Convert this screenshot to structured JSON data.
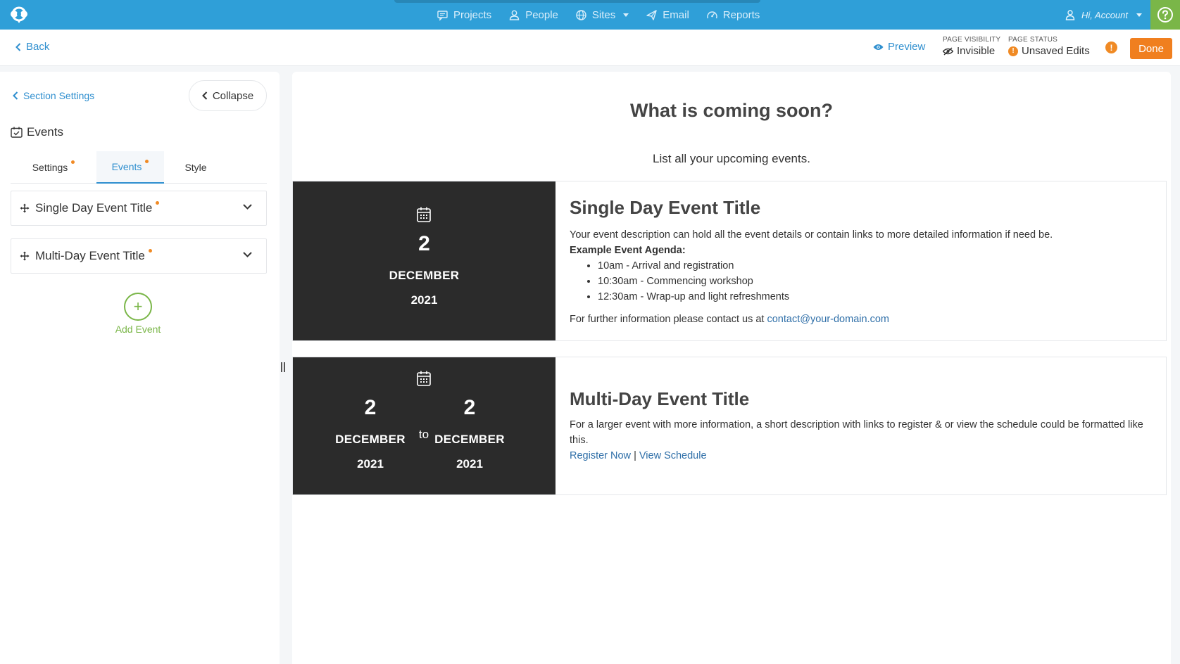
{
  "nav": {
    "items": [
      {
        "label": "Projects",
        "icon": "chat-icon"
      },
      {
        "label": "People",
        "icon": "person-icon"
      },
      {
        "label": "Sites",
        "icon": "globe-icon"
      },
      {
        "label": "Email",
        "icon": "paper-plane-icon"
      },
      {
        "label": "Reports",
        "icon": "gauge-icon"
      }
    ],
    "account_label": "Hi, Account",
    "brand_color": "#2f9fd8",
    "help_color": "#7ab648"
  },
  "subbar": {
    "back_label": "Back",
    "preview_label": "Preview",
    "visibility_label": "PAGE VISIBILITY",
    "visibility_value": "Invisible",
    "status_label": "PAGE STATUS",
    "status_value": "Unsaved Edits",
    "warn_symbol": "!",
    "done_label": "Done",
    "done_color": "#f07f1f"
  },
  "sidebar": {
    "section_settings_label": "Section Settings",
    "collapse_label": "Collapse",
    "heading": "Events",
    "tabs": [
      {
        "label": "Settings",
        "active": false,
        "has_dot": true
      },
      {
        "label": "Events",
        "active": true,
        "has_dot": true
      },
      {
        "label": "Style",
        "active": false,
        "has_dot": false
      }
    ],
    "events": [
      {
        "title": "Single Day Event Title"
      },
      {
        "title": "Multi-Day Event Title"
      }
    ],
    "add_symbol": "+",
    "add_event_label": "Add Event"
  },
  "content": {
    "title": "What is coming soon?",
    "subtitle": "List all your upcoming events.",
    "event1": {
      "day": "2",
      "month": "DECEMBER",
      "year": "2021",
      "title": "Single Day Event Title",
      "description": "Your event description can hold all the event details or contain links to more detailed information if need be.",
      "agenda_label": "Example Event Agenda:",
      "agenda": [
        "10am - Arrival and registration",
        "10:30am - Commencing workshop",
        "12:30am - Wrap-up and light refreshments"
      ],
      "contact_prefix": "For further information please contact us at ",
      "contact_email": "contact@your-domain.com"
    },
    "event2": {
      "start_day": "2",
      "start_month": "DECEMBER",
      "start_year": "2021",
      "to_label": "to",
      "end_day": "2",
      "end_month": "DECEMBER",
      "end_year": "2021",
      "title": "Multi-Day Event Title",
      "description": "For a larger event with more information, a short description with links to register & or view the schedule could be formatted like this.",
      "register_label": "Register Now",
      "separator": "|",
      "schedule_label": "View Schedule"
    }
  }
}
